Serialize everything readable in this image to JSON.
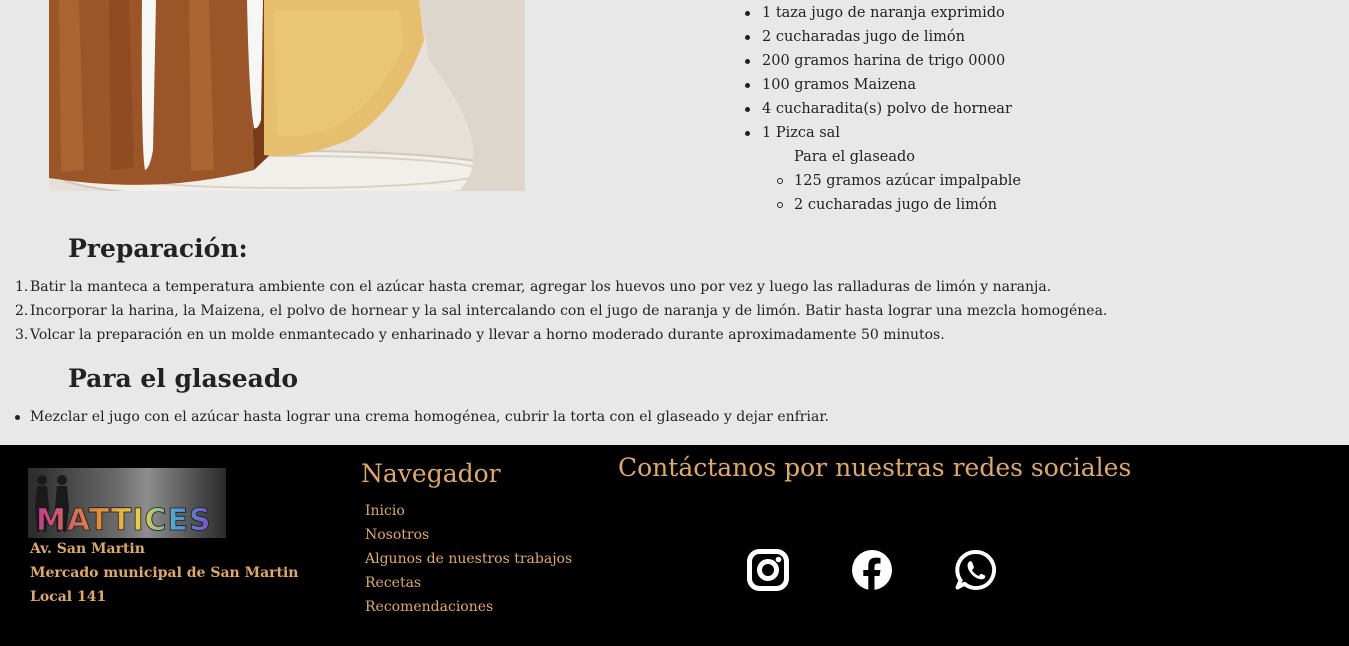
{
  "ingredients": [
    "1 taza jugo de naranja exprimido",
    "2 cucharadas jugo de limón",
    "200 gramos harina de trigo 0000",
    "100 gramos Maizena",
    "4 cucharadita(s) polvo de hornear",
    "1 Pizca sal"
  ],
  "glaze": {
    "title": "Para el glaseado",
    "items": [
      "125 gramos azúcar impalpable",
      "2 cucharadas jugo de limón"
    ]
  },
  "preparation": {
    "title": "Preparación:",
    "steps": [
      "Batir la manteca a temperatura ambiente con el azúcar hasta cremar, agregar los huevos uno por vez y luego las ralladuras de limón y naranja.",
      "Incorporar la harina, la Maizena, el polvo de hornear y la sal intercalando con el jugo de naranja y de limón. Batir hasta lograr una mezcla homogénea.",
      "Volcar la preparación en un molde enmantecado y enharinado y llevar a horno moderado durante aproximadamente 50 minutos."
    ]
  },
  "glaze_section": {
    "title": "Para el glaseado",
    "steps": [
      "Mezclar el jugo con el azúcar hasta lograr una crema homogénea, cubrir la torta con el glaseado y dejar enfriar."
    ]
  },
  "footer": {
    "logo_text": "MATTICES",
    "address": [
      "Av. San Martin",
      "Mercado municipal de San Martin",
      "Local 141"
    ],
    "nav_title": "Navegador",
    "nav_items": [
      "Inicio",
      "Nosotros",
      "Algunos de nuestros trabajos",
      "Recetas",
      "Recomendaciones"
    ],
    "social_title": "Contáctanos por nuestras redes sociales",
    "social_icons": [
      "instagram-icon",
      "facebook-icon",
      "whatsapp-icon"
    ]
  },
  "colors": {
    "page_bg": "#e8e8e8",
    "footer_bg": "#000000",
    "accent": "#e0a868",
    "text": "#222222"
  }
}
